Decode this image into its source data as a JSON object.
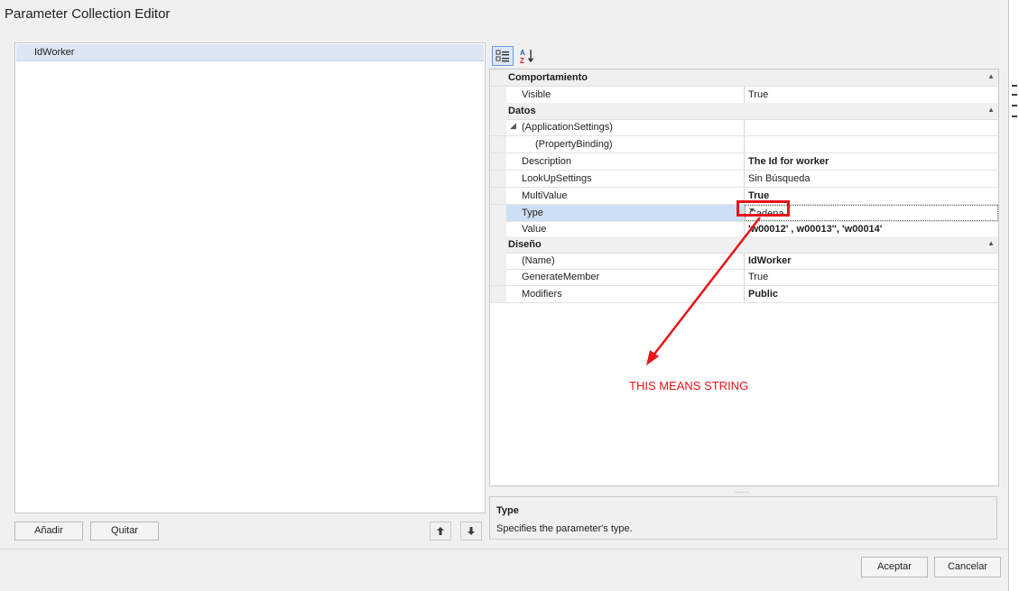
{
  "window": {
    "title": "Parameter Collection Editor"
  },
  "parameters": {
    "items": [
      "IdWorker"
    ]
  },
  "left_buttons": {
    "add": "Añadir",
    "remove": "Quitar"
  },
  "property_grid": {
    "categories": [
      {
        "name": "Comportamiento",
        "rows": [
          {
            "name": "Visible",
            "value": "True",
            "bold": false
          }
        ]
      },
      {
        "name": "Datos",
        "rows": [
          {
            "name": "(ApplicationSettings)",
            "value": "",
            "expander": "◢"
          },
          {
            "name": "(PropertyBinding)",
            "value": ""
          },
          {
            "name": "Description",
            "value": "The Id for worker",
            "bold": true
          },
          {
            "name": "LookUpSettings",
            "value": "Sin Búsqueda"
          },
          {
            "name": "MultiValue",
            "value": "True",
            "bold": true
          },
          {
            "name": "Type",
            "value": "Cadena",
            "selected": true
          },
          {
            "name": "Value",
            "value": "'w00012' , w00013'', 'w00014'",
            "bold": true
          }
        ]
      },
      {
        "name": "Diseño",
        "rows": [
          {
            "name": "(Name)",
            "value": "IdWorker",
            "bold": true
          },
          {
            "name": "GenerateMember",
            "value": "True"
          },
          {
            "name": "Modifiers",
            "value": "Public",
            "bold": true
          }
        ]
      }
    ]
  },
  "description_panel": {
    "title": "Type",
    "text": "Specifies the parameter's type."
  },
  "annotation": {
    "text": "THIS MEANS STRING",
    "color": "#e8141a"
  },
  "footer": {
    "ok": "Aceptar",
    "cancel": "Cancelar"
  }
}
